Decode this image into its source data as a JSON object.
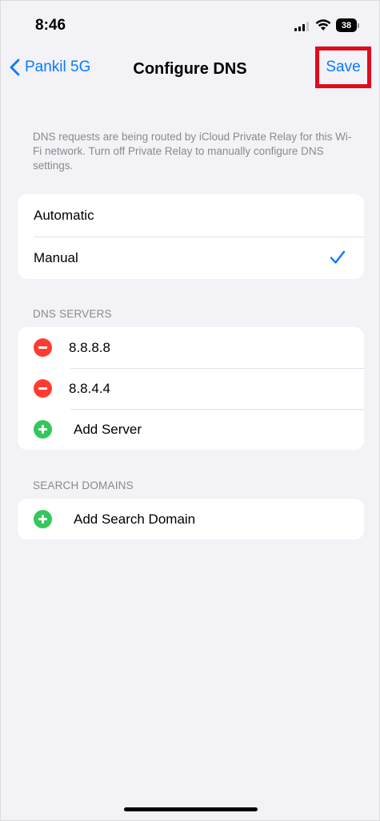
{
  "status_bar": {
    "time": "8:46",
    "battery": "38"
  },
  "nav": {
    "back_label": "Pankil 5G",
    "title": "Configure DNS",
    "save_label": "Save",
    "accent_color": "#0a7aff",
    "highlight_color": "#e00b1c"
  },
  "info": {
    "text": "DNS requests are being routed by iCloud Private Relay for this Wi-Fi network. Turn off Private Relay to manually configure DNS settings."
  },
  "mode": {
    "options": [
      {
        "label": "Automatic",
        "selected": false
      },
      {
        "label": "Manual",
        "selected": true
      }
    ]
  },
  "dns_servers": {
    "header": "DNS SERVERS",
    "servers": [
      "8.8.8.8",
      "8.8.4.4"
    ],
    "add_label": "Add Server"
  },
  "search_domains": {
    "header": "SEARCH DOMAINS",
    "add_label": "Add Search Domain"
  }
}
